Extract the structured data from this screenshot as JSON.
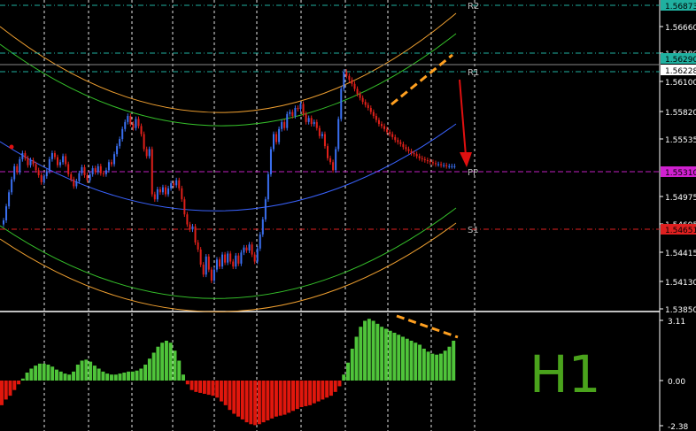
{
  "timeframe": "H1",
  "colors": {
    "background": "#000000",
    "grid": "#ffffff",
    "bull_candle": "#3a6ff0",
    "bear_candle": "#e0201a",
    "regression_mid": "#3a63ff",
    "channel_inner": "#35c02a",
    "channel_outer": "#f0a030",
    "pivot_line": "#c020c0",
    "r_line": "#20b0a0",
    "s_line": "#e02020",
    "hist_positive": "#4fc43a",
    "hist_negative": "#e0170d",
    "trend_dash": "#ffa020",
    "arrow": "#e01010",
    "axis_text": "#ffffff",
    "timeframe_text": "#4aa31c"
  },
  "axis": {
    "price_ticks": [
      "1.56660",
      "1.56380",
      "1.56100",
      "1.55820",
      "1.55535",
      "1.54975",
      "1.54695",
      "1.54415",
      "1.54130",
      "1.53850"
    ],
    "indicator_ticks": [
      "3.11",
      "0.00",
      "-2.38"
    ]
  },
  "pivots": {
    "R2": {
      "label": "R2",
      "price": 1.56873,
      "tag": "1.56873"
    },
    "R1": {
      "label": "R1",
      "price": 1.56228,
      "tag": "1.56228"
    },
    "PP": {
      "label": "PP",
      "price": 1.5531,
      "tag": "1.55310"
    },
    "S1": {
      "label": "S1",
      "price": 1.54651,
      "tag": "1.54651"
    }
  },
  "current_price_tag": "1.56290",
  "chart_data": [
    {
      "type": "candlestick",
      "title": "",
      "ylim": [
        1.5385,
        1.569
      ],
      "x": [
        0,
        1,
        2,
        3,
        4,
        5,
        6,
        7,
        8,
        9,
        10,
        11,
        12,
        13,
        14,
        15,
        16,
        17,
        18,
        19,
        20,
        21,
        22,
        23,
        24,
        25,
        26,
        27,
        28,
        29,
        30,
        31,
        32,
        33,
        34,
        35,
        36,
        37,
        38,
        39,
        40,
        41,
        42,
        43,
        44,
        45,
        46,
        47,
        48,
        49,
        50,
        51,
        52,
        53,
        54,
        55,
        56,
        57,
        58,
        59,
        60,
        61,
        62,
        63,
        64,
        65,
        66,
        67,
        68,
        69,
        70,
        71,
        72,
        73,
        74,
        75,
        76,
        77,
        78,
        79,
        80,
        81,
        82,
        83,
        84,
        85,
        86,
        87,
        88,
        89,
        90,
        91,
        92,
        93,
        94,
        95,
        96,
        97,
        98,
        99,
        100,
        101,
        102,
        103,
        104,
        105,
        106,
        107,
        108,
        109,
        110,
        111,
        112,
        113,
        114,
        115,
        116,
        117,
        118,
        119,
        120,
        121,
        122,
        123,
        124,
        125,
        126,
        127,
        128,
        129,
        130,
        131,
        132,
        133,
        134,
        135,
        136,
        137,
        138,
        139,
        140,
        141,
        142,
        143,
        144,
        145,
        146,
        147,
        148,
        149,
        150,
        151,
        152,
        153,
        154,
        155,
        156,
        157,
        158,
        159,
        160,
        161,
        162,
        163,
        164,
        165,
        166,
        167
      ],
      "close": [
        1.5474,
        1.5488,
        1.5502,
        1.5515,
        1.5528,
        1.5522,
        1.5535,
        1.5541,
        1.5536,
        1.5529,
        1.5534,
        1.553,
        1.5524,
        1.5519,
        1.5512,
        1.5518,
        1.5523,
        1.5535,
        1.5541,
        1.5537,
        1.5529,
        1.5532,
        1.5538,
        1.553,
        1.552,
        1.5515,
        1.5508,
        1.5513,
        1.5521,
        1.5527,
        1.5519,
        1.5514,
        1.552,
        1.5526,
        1.5522,
        1.5528,
        1.5521,
        1.552,
        1.5524,
        1.5532,
        1.553,
        1.554,
        1.5548,
        1.5555,
        1.5565,
        1.5572,
        1.5578,
        1.557,
        1.5566,
        1.5575,
        1.5568,
        1.556,
        1.5545,
        1.5538,
        1.5545,
        1.55,
        1.5495,
        1.5505,
        1.5502,
        1.5507,
        1.55,
        1.5506,
        1.5511,
        1.5509,
        1.5514,
        1.5506,
        1.5495,
        1.548,
        1.547,
        1.5465,
        1.5468,
        1.5452,
        1.5445,
        1.543,
        1.542,
        1.5438,
        1.5425,
        1.5414,
        1.5425,
        1.5435,
        1.5428,
        1.544,
        1.5432,
        1.5441,
        1.5433,
        1.5428,
        1.5439,
        1.5431,
        1.5442,
        1.5447,
        1.5444,
        1.545,
        1.544,
        1.5433,
        1.5446,
        1.546,
        1.5475,
        1.5495,
        1.552,
        1.5545,
        1.556,
        1.5552,
        1.5565,
        1.5572,
        1.5566,
        1.558,
        1.5582,
        1.5578,
        1.5586,
        1.5585,
        1.559,
        1.558,
        1.5572,
        1.5576,
        1.557,
        1.5572,
        1.5566,
        1.5558,
        1.556,
        1.5548,
        1.5536,
        1.5532,
        1.5524,
        1.5545,
        1.5575,
        1.5605,
        1.5622,
        1.5618,
        1.5614,
        1.561,
        1.5605,
        1.56,
        1.5596,
        1.5592,
        1.5589,
        1.5586,
        1.5582,
        1.5578,
        1.5574,
        1.557,
        1.5568,
        1.5565,
        1.5562,
        1.556,
        1.5557,
        1.5554,
        1.5552,
        1.555,
        1.5547,
        1.5545,
        1.5543,
        1.5541,
        1.554,
        1.5538,
        1.5536,
        1.5535,
        1.5534,
        1.5533,
        1.5532,
        1.5531,
        1.553,
        1.553,
        1.5529,
        1.5529,
        1.5528,
        1.5528,
        1.5528,
        1.5528,
        1.5528,
        1.5528
      ]
    },
    {
      "type": "bar",
      "title": "",
      "ylim": [
        -2.38,
        3.11
      ],
      "values": [
        -1.3,
        -1.0,
        -0.8,
        -0.5,
        -0.2,
        0.1,
        0.4,
        0.6,
        0.75,
        0.85,
        0.85,
        0.8,
        0.7,
        0.55,
        0.45,
        0.35,
        0.3,
        0.45,
        0.8,
        1.0,
        1.05,
        0.95,
        0.75,
        0.6,
        0.45,
        0.35,
        0.3,
        0.3,
        0.35,
        0.4,
        0.45,
        0.45,
        0.5,
        0.6,
        0.8,
        1.1,
        1.4,
        1.7,
        1.9,
        2.0,
        1.9,
        1.5,
        1.0,
        0.3,
        -0.2,
        -0.5,
        -0.6,
        -0.65,
        -0.7,
        -0.75,
        -0.8,
        -0.9,
        -1.1,
        -1.3,
        -1.55,
        -1.75,
        -1.9,
        -2.05,
        -2.2,
        -2.3,
        -2.35,
        -2.3,
        -2.2,
        -2.1,
        -2.0,
        -1.9,
        -1.85,
        -1.8,
        -1.7,
        -1.6,
        -1.5,
        -1.4,
        -1.35,
        -1.3,
        -1.2,
        -1.1,
        -1.0,
        -0.9,
        -0.8,
        -0.6,
        -0.3,
        0.3,
        0.9,
        1.6,
        2.2,
        2.7,
        3.0,
        3.1,
        3.0,
        2.85,
        2.7,
        2.6,
        2.5,
        2.4,
        2.3,
        2.2,
        2.1,
        2.0,
        1.9,
        1.8,
        1.6,
        1.45,
        1.35,
        1.3,
        1.35,
        1.5,
        1.7,
        2.0
      ]
    }
  ]
}
